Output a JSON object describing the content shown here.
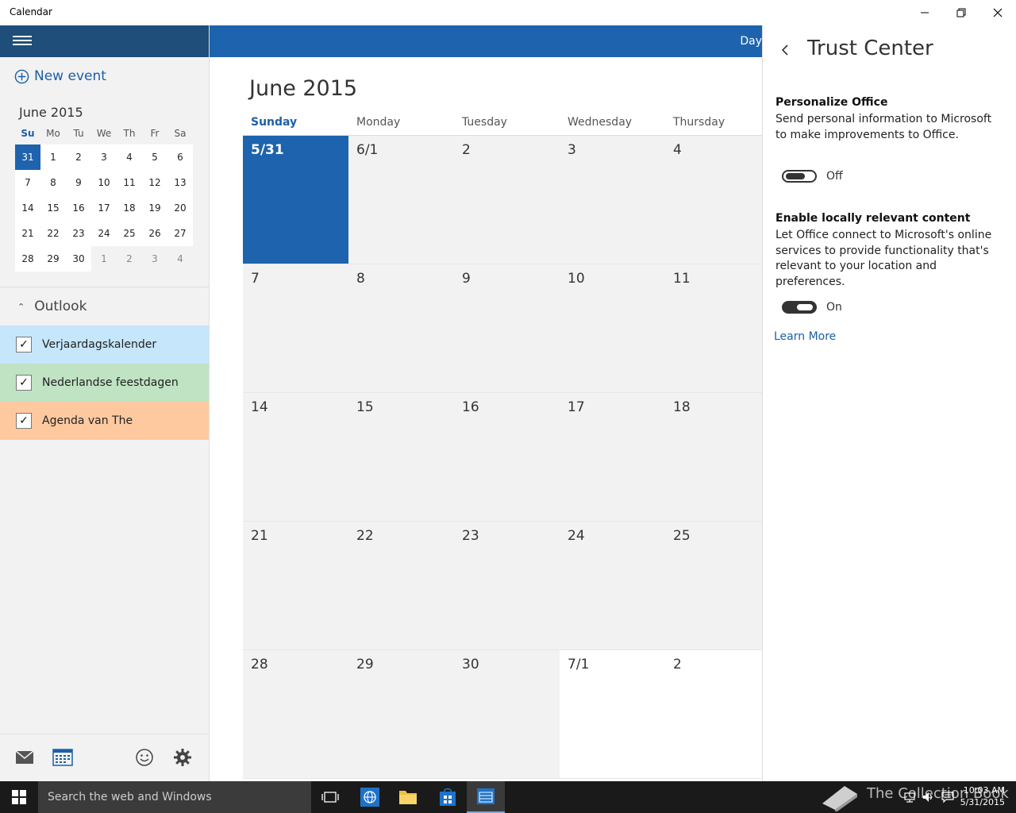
{
  "window": {
    "title": "Calendar"
  },
  "sidebar": {
    "new_event_label": "New event",
    "mini_calendar": {
      "title": "June 2015",
      "weekdays": [
        "Su",
        "Mo",
        "Tu",
        "We",
        "Th",
        "Fr",
        "Sa"
      ],
      "weeks": [
        [
          "31",
          "1",
          "2",
          "3",
          "4",
          "5",
          "6"
        ],
        [
          "7",
          "8",
          "9",
          "10",
          "11",
          "12",
          "13"
        ],
        [
          "14",
          "15",
          "16",
          "17",
          "18",
          "19",
          "20"
        ],
        [
          "21",
          "22",
          "23",
          "24",
          "25",
          "26",
          "27"
        ],
        [
          "28",
          "29",
          "30",
          "1",
          "2",
          "3",
          "4"
        ]
      ]
    },
    "group_label": "Outlook",
    "calendars": [
      {
        "label": "Verjaardagskalender",
        "color": "#c5e6fb",
        "checked": true
      },
      {
        "label": "Nederlandse feestdagen",
        "color": "#bfe3c3",
        "checked": true
      },
      {
        "label": "Agenda van The",
        "color": "#ffc9a0",
        "checked": true
      }
    ]
  },
  "main": {
    "view_label": "Day",
    "month_title": "June 2015",
    "weekdays": [
      "Sunday",
      "Monday",
      "Tuesday",
      "Wednesday",
      "Thursday"
    ],
    "weeks": [
      [
        "5/31",
        "6/1",
        "2",
        "3",
        "4"
      ],
      [
        "7",
        "8",
        "9",
        "10",
        "11"
      ],
      [
        "14",
        "15",
        "16",
        "17",
        "18"
      ],
      [
        "21",
        "22",
        "23",
        "24",
        "25"
      ],
      [
        "28",
        "29",
        "30",
        "7/1",
        "2"
      ]
    ]
  },
  "panel": {
    "title": "Trust Center",
    "sections": [
      {
        "title": "Personalize Office",
        "description": "Send personal information to Microsoft to make improvements to Office.",
        "toggle_state": "Off"
      },
      {
        "title": "Enable locally relevant content",
        "description": "Let Office connect to Microsoft's online services to provide functionality that's relevant to your location and preferences.",
        "toggle_state": "On"
      }
    ],
    "learn_more": "Learn More"
  },
  "taskbar": {
    "search_placeholder": "Search the web and Windows",
    "watermark": "The Collection Book",
    "time": "10:03 AM",
    "date": "5/31/2015"
  },
  "colors": {
    "accent": "#1e63ad",
    "header_dark": "#1e4e79",
    "link": "#1b5fa8"
  }
}
